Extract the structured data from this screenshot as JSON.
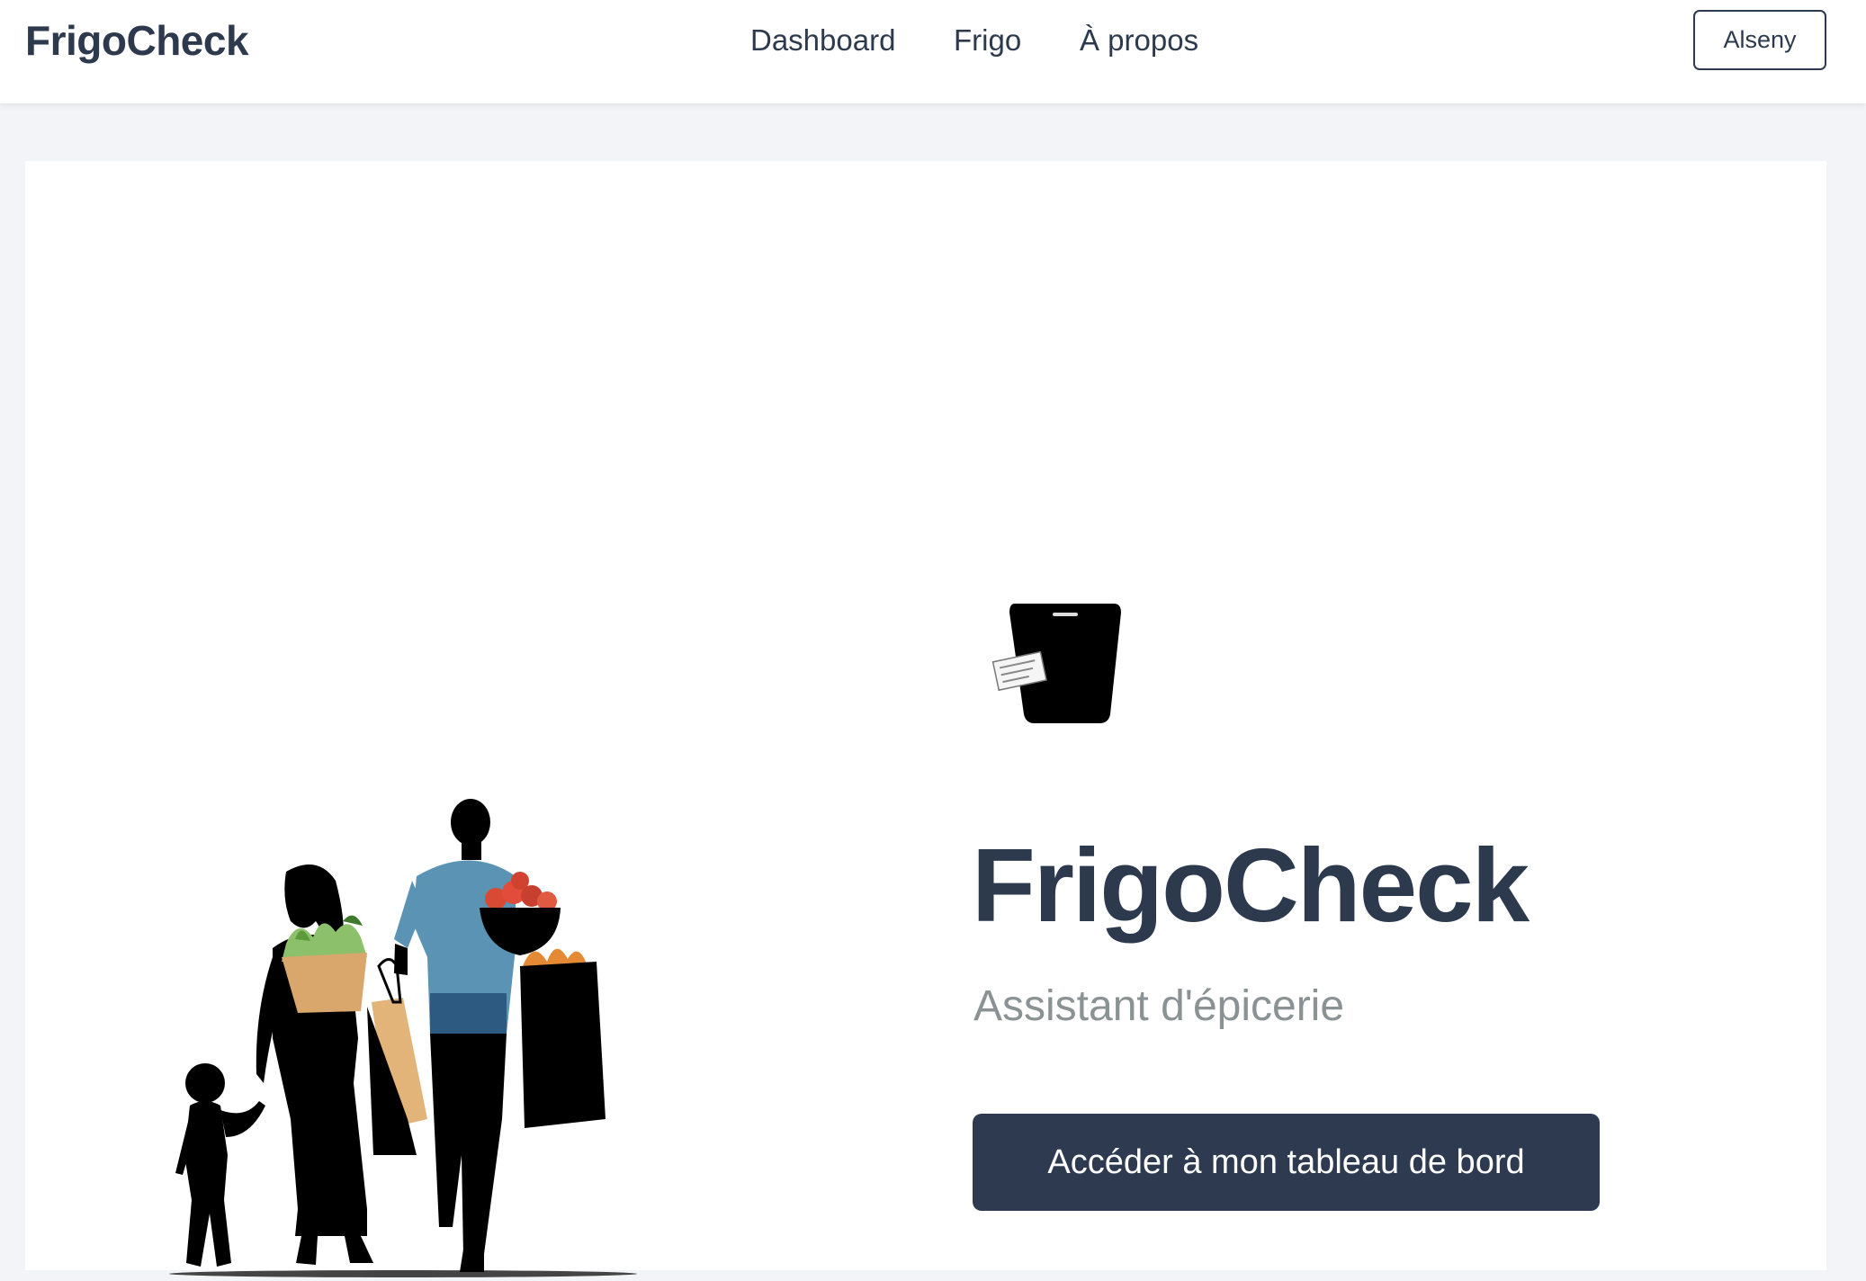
{
  "navbar": {
    "brand": "FrigoCheck",
    "links": [
      {
        "label": "Dashboard"
      },
      {
        "label": "Frigo"
      },
      {
        "label": "À propos"
      }
    ],
    "user_button": "Alseny"
  },
  "hero": {
    "title": "FrigoCheck",
    "subtitle": "Assistant d'épicerie",
    "cta_label": "Accéder à mon tableau de bord",
    "illustration_icon": "family-shopping-illustration",
    "logo_icon": "phone-receipt-icon"
  },
  "colors": {
    "primary": "#2e3a4f",
    "page_background": "#f3f4f7",
    "card_background": "#ffffff",
    "subtitle": "#8a9294"
  }
}
